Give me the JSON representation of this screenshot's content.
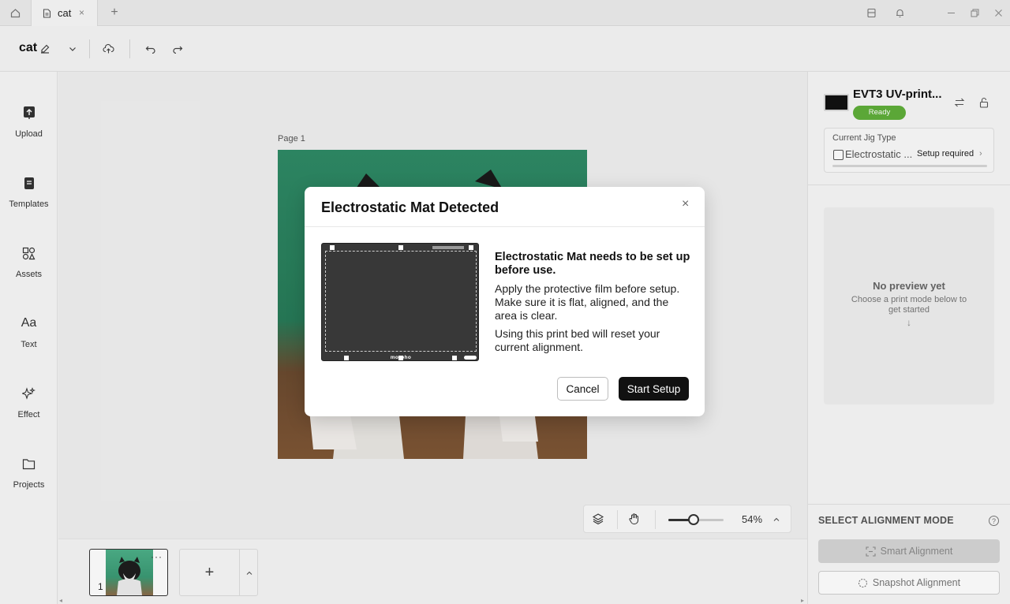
{
  "titlebar": {
    "tab_title": "cat",
    "tab_close": "×",
    "new_tab": "+"
  },
  "toolbar": {
    "doc_title": "cat"
  },
  "sidebar": {
    "items": [
      {
        "label": "Upload",
        "icon": "upload-icon"
      },
      {
        "label": "Templates",
        "icon": "templates-icon"
      },
      {
        "label": "Assets",
        "icon": "assets-icon"
      },
      {
        "label": "Text",
        "icon": "text-icon"
      },
      {
        "label": "Effect",
        "icon": "effect-icon"
      },
      {
        "label": "Projects",
        "icon": "folder-icon"
      }
    ],
    "text_glyph": "Aa"
  },
  "canvas": {
    "page_label": "Page 1",
    "zoom_level": "54%",
    "zoom_fraction": 0.45
  },
  "pages": {
    "thumb_number": "1",
    "thumb_more": "···",
    "add_page": "+"
  },
  "device": {
    "name": "EVT3 UV-print...",
    "status": "Ready",
    "status_color": "#5fae3a",
    "jig_label": "Current Jig Type",
    "jig_name": "Electrostatic ...",
    "jig_action": "Setup required",
    "jig_chevron": "›"
  },
  "preview": {
    "title": "No preview yet",
    "subtitle": "Choose a print mode below to get started",
    "arrow": "↓"
  },
  "alignment": {
    "title": "SELECT ALIGNMENT MODE",
    "help": "?",
    "smart_label": "Smart Alignment",
    "snapshot_label": "Snapshot Alignment"
  },
  "modal": {
    "title": "Electrostatic Mat Detected",
    "close": "×",
    "heading": "Electrostatic Mat needs to be set up before use.",
    "paragraph1": "Apply the protective film before setup. Make sure it is flat, aligned, and the area is clear.",
    "paragraph2": "Using this print bed will reset your current alignment.",
    "mat_brand": "morpho",
    "cancel_label": "Cancel",
    "start_label": "Start Setup"
  }
}
